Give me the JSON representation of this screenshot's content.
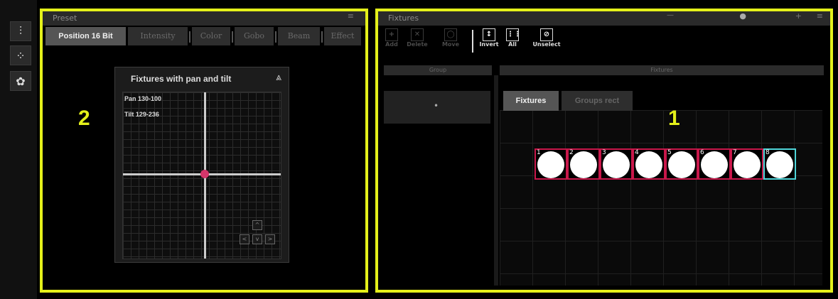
{
  "preset": {
    "title": "Preset",
    "tabs": [
      "Position 16 Bit",
      "Intensity",
      "Color",
      "Gobo",
      "Beam",
      "Effect"
    ],
    "label": "2",
    "pantilt": {
      "header": "Fixtures with pan and tilt",
      "pan": "Pan 130-100",
      "tilt": "Tilt 129-236",
      "step_buttons": [
        "^",
        "<",
        "v",
        ">"
      ]
    }
  },
  "fixtures": {
    "title": "Fixtures",
    "label": "1",
    "toolbar": [
      "Add",
      "Delete",
      "Move",
      "Invert",
      "All",
      "Unselect"
    ],
    "toolbar_icons": [
      "+",
      "✕",
      "◯",
      "↕",
      "⋮⋮",
      "⊘"
    ],
    "group_header": "Group",
    "fixtures_header": "Fixtures",
    "group_item": "•",
    "tabs": [
      "Fixtures",
      "Groups rect"
    ],
    "items": [
      {
        "num": "1",
        "selected": false
      },
      {
        "num": "2",
        "selected": false
      },
      {
        "num": "3",
        "selected": false
      },
      {
        "num": "4",
        "selected": false
      },
      {
        "num": "5",
        "selected": false
      },
      {
        "num": "6",
        "selected": false
      },
      {
        "num": "7",
        "selected": false
      },
      {
        "num": "8",
        "selected": true
      }
    ],
    "colors": {
      "unselected": "#c8174a",
      "selected": "#4fd5d9"
    }
  },
  "highlight_color": "#e4f01a"
}
